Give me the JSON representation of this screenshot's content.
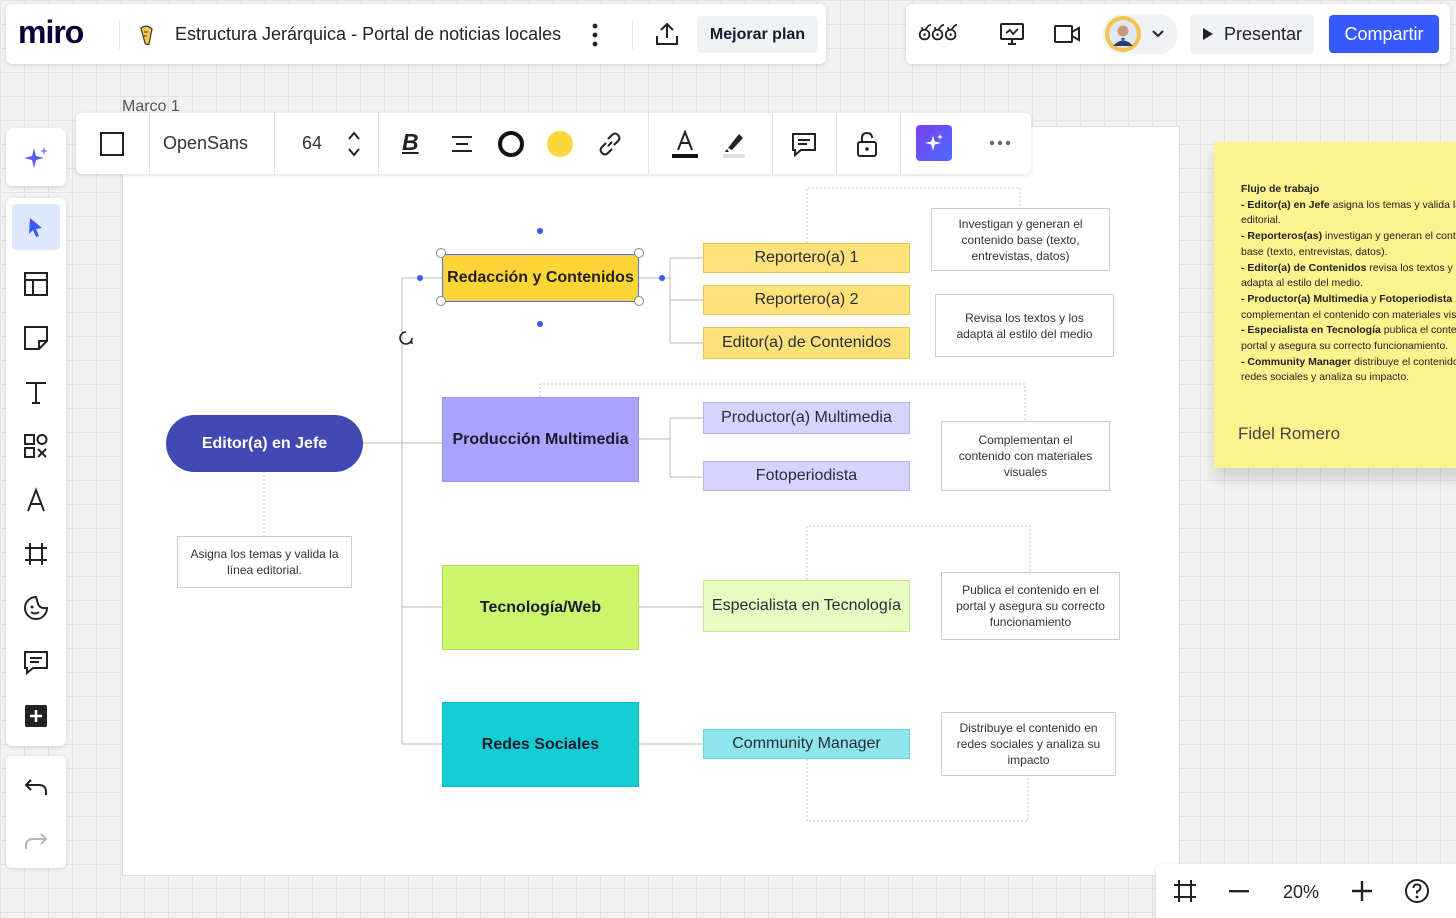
{
  "header": {
    "logo": "miro",
    "board_title": "Estructura Jerárquica - Portal de noticias locales",
    "upgrade_label": "Mejorar plan",
    "present_label": "Presentar",
    "share_label": "Compartir",
    "reactions_label": "ఠఠఠ"
  },
  "colors": {
    "accent": "#3859ff",
    "root": "#4148b4",
    "redaccion": "#fdd535",
    "multimedia": "#aaa3ff",
    "tecnologia": "#cdf56c",
    "redes": "#14cdd4",
    "sticky": "#fbf38e"
  },
  "frame": {
    "label": "Marco 1"
  },
  "format_toolbar": {
    "font": "OpenSans",
    "font_size": "64",
    "bold_label": "B"
  },
  "mindmap": {
    "root": {
      "label": "Editor(a) en Jefe",
      "note": "Asigna los temas y valida la línea editorial."
    },
    "branches": [
      {
        "label": "Redacción y Contenidos",
        "roles": [
          "Reportero(a) 1",
          "Reportero(a) 2",
          "Editor(a) de Contenidos"
        ],
        "notes": [
          "Investigan y generan el contenido base (texto, entrevistas, datos)",
          "Revisa los textos y los adapta al estilo del medio"
        ]
      },
      {
        "label": "Producción Multimedia",
        "roles": [
          "Productor(a) Multimedia",
          "Fotoperiodista"
        ],
        "notes": [
          "Complementan el contenido con materiales visuales"
        ]
      },
      {
        "label": "Tecnología/Web",
        "roles": [
          "Especialista en Tecnología"
        ],
        "notes": [
          "Publica el contenido en el portal y asegura su correcto funcionamiento"
        ]
      },
      {
        "label": "Redes Sociales",
        "roles": [
          "Community Manager"
        ],
        "notes": [
          "Distribuye el contenido en redes sociales y analiza su impacto"
        ]
      }
    ]
  },
  "sticky": {
    "title": "Flujo de trabajo",
    "lines": [
      {
        "b": "- Editor(a) en Jefe",
        "t": " asigna los temas y valida la"
      },
      {
        "b": "",
        "t": "editorial."
      },
      {
        "b": "- Reporteros(as)",
        "t": " investigan y generan el contenido"
      },
      {
        "b": "",
        "t": "base (texto, entrevistas, datos)."
      },
      {
        "b": "- Editor(a) de Contenidos",
        "t": " revisa los textos y los"
      },
      {
        "b": "",
        "t": "adapta al estilo del medio."
      },
      {
        "b": "- Productor(a) Multimedia",
        "t": " y "
      },
      {
        "b": "",
        "t": "complementan el contenido con materiales visuales."
      },
      {
        "b": "- Especialista en Tecnología",
        "t": " publica el contenido en el"
      },
      {
        "b": "",
        "t": "portal y asegura su correcto funcionamiento."
      },
      {
        "b": "- Community Manager",
        "t": " distribuye el contenido en"
      },
      {
        "b": "",
        "t": "redes sociales y analiza su impacto."
      }
    ],
    "extra_bold": "Fotoperiodista",
    "author": "Fidel Romero"
  },
  "zoom": {
    "level": "20%"
  }
}
